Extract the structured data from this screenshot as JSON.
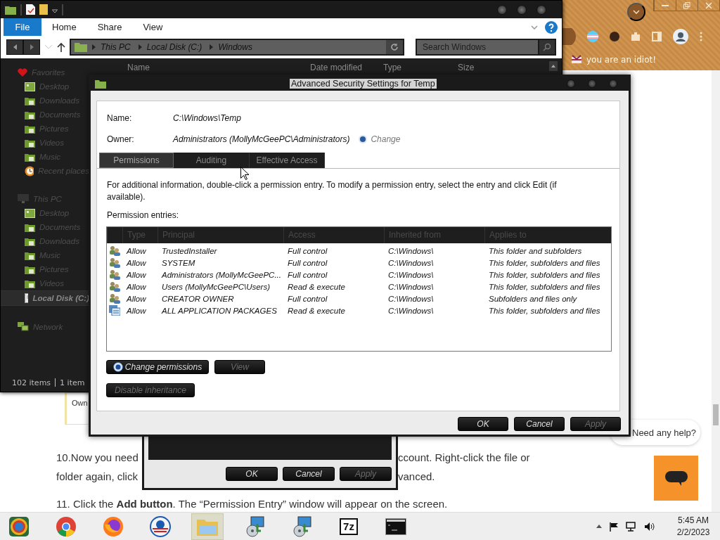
{
  "browser": {
    "bookmark": "you are an idiot!",
    "card_text": "Own",
    "article": [
      {
        "kind": "split",
        "parts": [
          "10.Now you need",
          "ccount. Right-click the file or"
        ]
      },
      {
        "kind": "split",
        "parts": [
          "folder again, click",
          "vanced."
        ]
      },
      {
        "kind": "full",
        "text": "11. Click the **Add button**. The “Permission Entry” window will appear on the screen."
      }
    ],
    "chat_prompt": "Need any help?"
  },
  "explorer": {
    "ribbon_tabs": [
      {
        "label": "File",
        "kind": "file"
      },
      {
        "label": "Home",
        "kind": "tab"
      },
      {
        "label": "Share",
        "kind": "tab"
      },
      {
        "label": "View",
        "kind": "tab"
      }
    ],
    "breadcrumbs": [
      "This PC",
      "Local Disk (C:)",
      "Windows"
    ],
    "search": {
      "placeholder": "Search Windows"
    },
    "columns": [
      "Name",
      "Date modified",
      "Type",
      "Size"
    ],
    "nav": [
      {
        "label": "Favorites",
        "kind": "favorites",
        "selected": false,
        "children": [
          {
            "label": "Desktop",
            "kind": "desktop",
            "selected": false
          },
          {
            "label": "Downloads",
            "kind": "folder",
            "selected": false
          },
          {
            "label": "Documents",
            "kind": "folder",
            "selected": false
          },
          {
            "label": "Pictures",
            "kind": "folder",
            "selected": false
          },
          {
            "label": "Videos",
            "kind": "folder",
            "selected": false
          },
          {
            "label": "Music",
            "kind": "folder",
            "selected": false
          },
          {
            "label": "Recent places",
            "kind": "recent",
            "selected": false
          }
        ]
      },
      {
        "label": "This PC",
        "kind": "pc",
        "selected": false,
        "children": [
          {
            "label": "Desktop",
            "kind": "desktop",
            "selected": false
          },
          {
            "label": "Documents",
            "kind": "folder",
            "selected": false
          },
          {
            "label": "Downloads",
            "kind": "folder",
            "selected": false
          },
          {
            "label": "Music",
            "kind": "folder",
            "selected": false
          },
          {
            "label": "Pictures",
            "kind": "folder",
            "selected": false
          },
          {
            "label": "Videos",
            "kind": "folder",
            "selected": false
          },
          {
            "label": "Local Disk (C:)",
            "kind": "drive",
            "selected": true
          }
        ]
      },
      {
        "label": "Network",
        "kind": "network",
        "selected": false
      }
    ],
    "status_bar": [
      "102 items",
      "1 item"
    ]
  },
  "back_dialog": {
    "buttons": [
      {
        "label": "OK",
        "disabled": false
      },
      {
        "label": "Cancel",
        "disabled": false
      },
      {
        "label": "Apply",
        "disabled": true
      }
    ]
  },
  "dialog": {
    "title": "Advanced Security Settings for Temp",
    "fields": [
      {
        "label": "Name:",
        "value": "C:\\Windows\\Temp"
      },
      {
        "label": "Owner:",
        "value": "Administrators (MollyMcGeePC\\Administrators)",
        "action": "Change"
      }
    ],
    "tabs": [
      {
        "label": "Permissions",
        "selected": true
      },
      {
        "label": "Auditing",
        "selected": false
      },
      {
        "label": "Effective Access",
        "selected": false
      }
    ],
    "info": "For additional information, double-click a permission entry. To modify a permission entry, select the entry and click Edit (if available).",
    "entries_label": "Permission entries:",
    "table": {
      "columns": [
        "Type",
        "Principal",
        "Access",
        "Inherited from",
        "Applies to"
      ],
      "rows": [
        {
          "kind": "user",
          "cells": [
            "Allow",
            "TrustedInstaller",
            "Full control",
            "C:\\Windows\\",
            "This folder and subfolders"
          ]
        },
        {
          "kind": "user",
          "cells": [
            "Allow",
            "SYSTEM",
            "Full control",
            "C:\\Windows\\",
            "This folder, subfolders and files"
          ]
        },
        {
          "kind": "user",
          "cells": [
            "Allow",
            "Administrators (MollyMcGeePC...",
            "Full control",
            "C:\\Windows\\",
            "This folder, subfolders and files"
          ]
        },
        {
          "kind": "user",
          "cells": [
            "Allow",
            "Users (MollyMcGeePC\\Users)",
            "Read & execute",
            "C:\\Windows\\",
            "This folder, subfolders and files"
          ]
        },
        {
          "kind": "user",
          "cells": [
            "Allow",
            "CREATOR OWNER",
            "Full control",
            "C:\\Windows\\",
            "Subfolders and files only"
          ]
        },
        {
          "kind": "package",
          "cells": [
            "Allow",
            "ALL APPLICATION PACKAGES",
            "Read & execute",
            "C:\\Windows\\",
            "This folder, subfolders and files"
          ]
        }
      ]
    },
    "buttons": [
      {
        "label": "Change permissions",
        "disabled": false,
        "kind": "shield"
      },
      {
        "label": "View",
        "disabled": true,
        "kind": "plain"
      }
    ],
    "inheritance_button": {
      "label": "Disable inheritance",
      "disabled": true
    },
    "footer_buttons": [
      {
        "label": "OK",
        "disabled": false
      },
      {
        "label": "Cancel",
        "disabled": false
      },
      {
        "label": "Apply",
        "disabled": true
      }
    ]
  },
  "taskbar": {
    "apps": [
      {
        "kind": "start",
        "selected": false
      },
      {
        "kind": "chrome",
        "selected": false
      },
      {
        "kind": "firefox",
        "selected": false
      },
      {
        "kind": "circle",
        "selected": false
      },
      {
        "kind": "folder",
        "selected": true
      },
      {
        "kind": "installer",
        "selected": false
      },
      {
        "kind": "installer",
        "selected": false
      },
      {
        "kind": "archive",
        "label": "7z",
        "selected": false
      },
      {
        "kind": "console",
        "selected": false
      }
    ],
    "clock": {
      "time": "5:45 AM",
      "date": "2/2/2023"
    }
  }
}
